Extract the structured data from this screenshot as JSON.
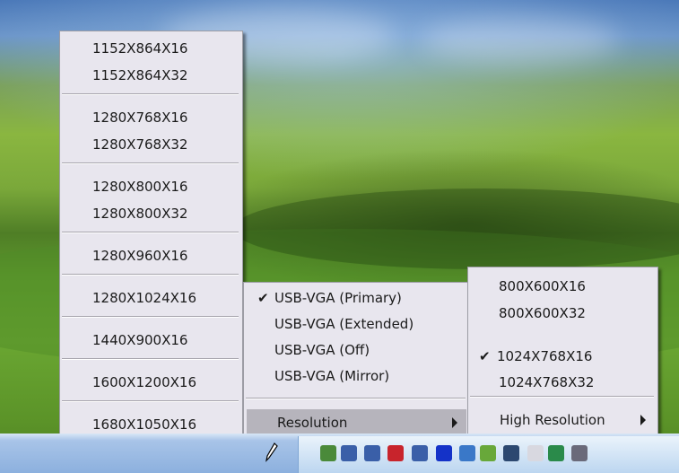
{
  "desktop": {
    "colors": {
      "sky": "#6a94c8",
      "grass": "#7aa83a",
      "menu_bg": "#e8e6ee",
      "highlight": "#b6b4bc",
      "taskbar": "#a8c4e8"
    }
  },
  "resolution_menu_left": {
    "groups": [
      [
        "1152X864X16",
        "1152X864X32"
      ],
      [
        "1280X768X16",
        "1280X768X32"
      ],
      [
        "1280X800X16",
        "1280X800X32"
      ],
      [
        "1280X960X16"
      ],
      [
        "1280X1024X16"
      ],
      [
        "1440X900X16"
      ],
      [
        "1600X1200X16"
      ],
      [
        "1680X1050X16"
      ]
    ]
  },
  "context_menu": {
    "items": [
      {
        "label": "USB-VGA (Primary)",
        "checked": true
      },
      {
        "label": "USB-VGA (Extended)",
        "checked": false
      },
      {
        "label": "USB-VGA (Off)",
        "checked": false
      },
      {
        "label": "USB-VGA (Mirror)",
        "checked": false
      }
    ],
    "resolution_label": "Resolution",
    "check_glyph": "✔"
  },
  "resolution_submenu": {
    "items": [
      {
        "label": "800X600X16",
        "checked": false
      },
      {
        "label": "800X600X32",
        "checked": false
      },
      {
        "label": "1024X768X16",
        "checked": true
      },
      {
        "label": "1024X768X32",
        "checked": false
      }
    ],
    "high_resolution_label": "High Resolution"
  },
  "taskbar": {
    "tray_icons": [
      "usb-display-icon",
      "network-disconnected-icon",
      "network-warning-icon",
      "security-shield-icon",
      "network-error-icon",
      "antivirus-icon",
      "network-icon",
      "nvidia-icon",
      "display-icon",
      "blocked-icon",
      "fullscreen-icon",
      "volume-icon"
    ]
  }
}
